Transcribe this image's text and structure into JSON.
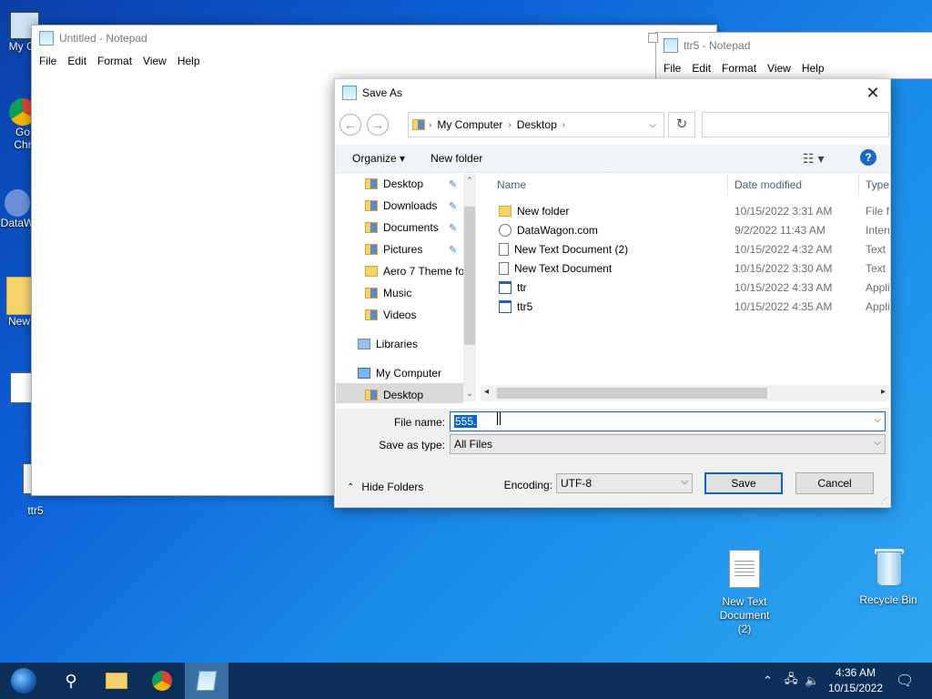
{
  "desktop": {
    "icons_left": [
      {
        "label": "My Co"
      },
      {
        "label": "Go\nChr"
      },
      {
        "label": "DataW"
      },
      {
        "label": "New"
      },
      {
        "label": ""
      },
      {
        "label": "ttr5"
      }
    ],
    "new_text_doc": "New Text Document (2)",
    "recycle_bin": "Recycle Bin"
  },
  "notepad_main": {
    "title": "Untitled - Notepad",
    "menu": [
      "File",
      "Edit",
      "Format",
      "View",
      "Help"
    ]
  },
  "notepad_ttr5": {
    "title": "ttr5 - Notepad",
    "menu": [
      "File",
      "Edit",
      "Format",
      "View",
      "Help"
    ]
  },
  "dialog": {
    "title": "Save As",
    "address": [
      "My Computer",
      "Desktop"
    ],
    "search_placeholder": "",
    "organize": "Organize",
    "new_folder": "New folder",
    "tree": [
      {
        "label": "Desktop",
        "pinned": true
      },
      {
        "label": "Downloads",
        "pinned": true
      },
      {
        "label": "Documents",
        "pinned": true
      },
      {
        "label": "Pictures",
        "pinned": true
      },
      {
        "label": "Aero 7 Theme fo",
        "pinned": false
      },
      {
        "label": "Music",
        "pinned": false
      },
      {
        "label": "Videos",
        "pinned": false
      },
      {
        "label": "Libraries",
        "pinned": false
      },
      {
        "label": "My Computer",
        "pinned": false
      },
      {
        "label": "Desktop",
        "pinned": false
      }
    ],
    "columns": [
      "Name",
      "Date modified",
      "Type"
    ],
    "files": [
      {
        "name": "New folder",
        "date": "10/15/2022 3:31 AM",
        "type": "File fo",
        "icon": "folder"
      },
      {
        "name": "DataWagon.com",
        "date": "9/2/2022 11:43 AM",
        "type": "Intern",
        "icon": "link"
      },
      {
        "name": "New Text Document (2)",
        "date": "10/15/2022 4:32 AM",
        "type": "Text D",
        "icon": "txt"
      },
      {
        "name": "New Text Document",
        "date": "10/15/2022 3:30 AM",
        "type": "Text D",
        "icon": "txt"
      },
      {
        "name": "ttr",
        "date": "10/15/2022 4:33 AM",
        "type": "Appli",
        "icon": "app"
      },
      {
        "name": "ttr5",
        "date": "10/15/2022 4:35 AM",
        "type": "Appli",
        "icon": "app"
      }
    ],
    "file_name_label": "File name:",
    "file_name_value": "555.",
    "save_type_label": "Save as type:",
    "save_type_value": "All Files",
    "hide_folders": "Hide Folders",
    "encoding_label": "Encoding:",
    "encoding_value": "UTF-8",
    "save_btn": "Save",
    "cancel_btn": "Cancel"
  },
  "taskbar": {
    "time": "4:36 AM",
    "date": "10/15/2022"
  }
}
